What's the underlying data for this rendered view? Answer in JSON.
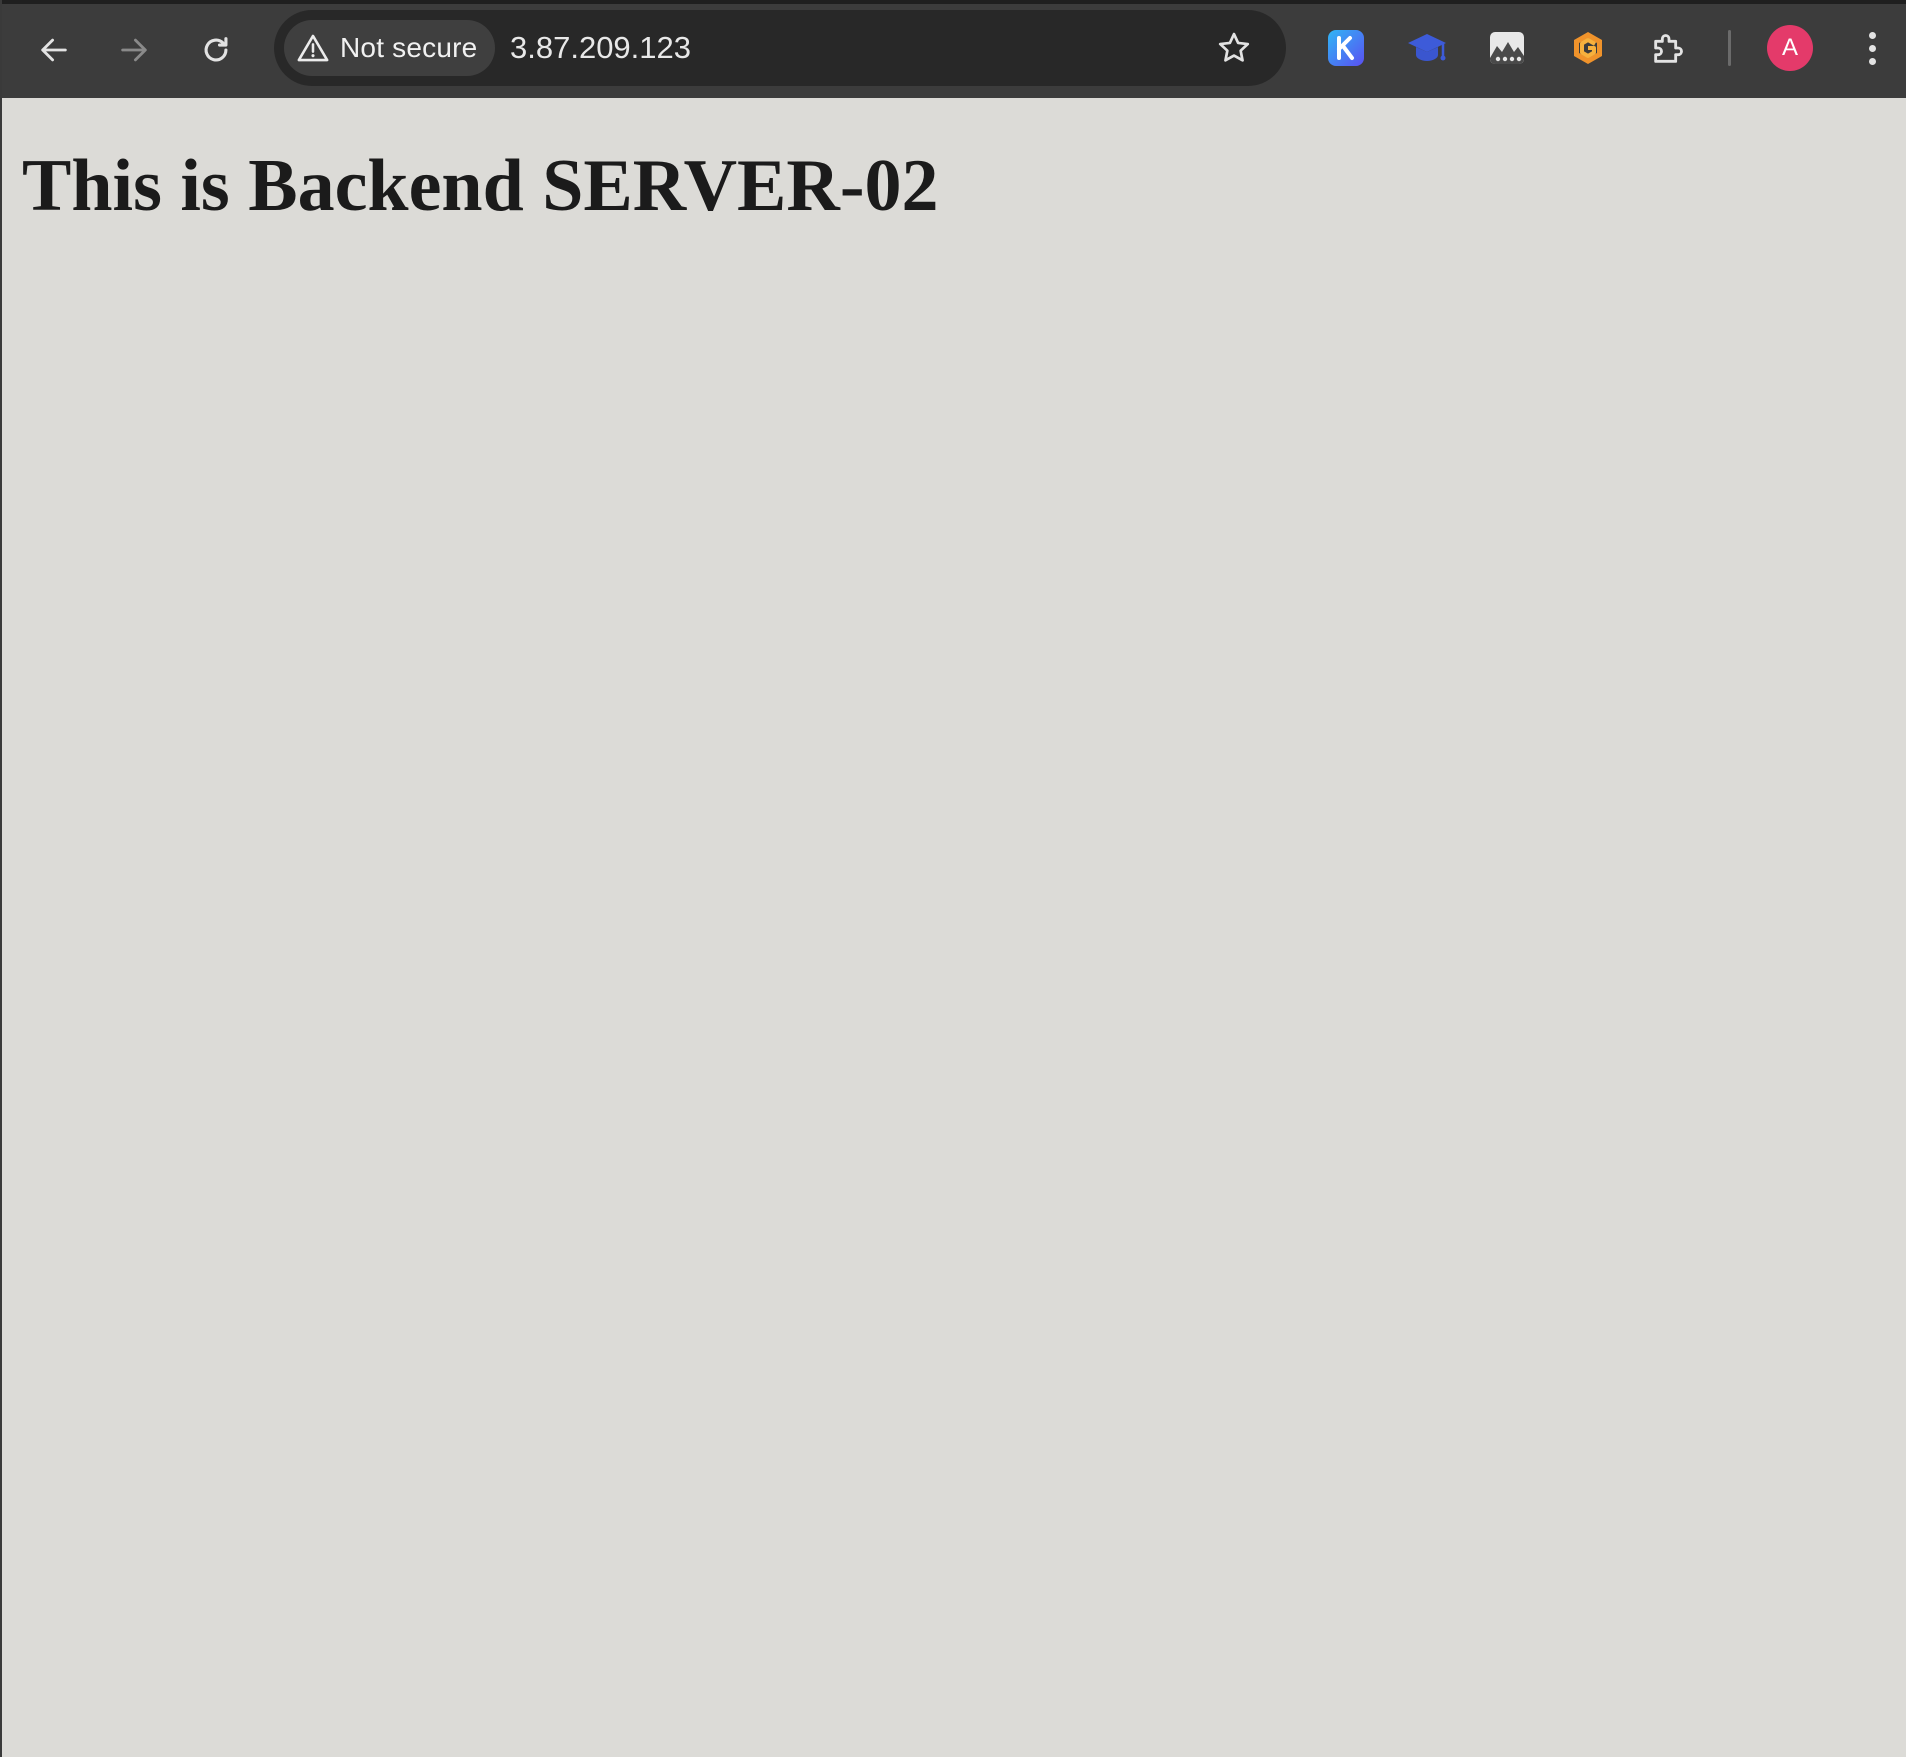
{
  "browser": {
    "security": {
      "label": "Not secure",
      "icon": "warning-triangle-icon"
    },
    "address": {
      "url": "3.87.209.123"
    },
    "extensions": [
      {
        "name": "k-extension-icon",
        "glyph": "K",
        "color": "#3e7bf7"
      },
      {
        "name": "graduation-cap-icon",
        "color": "#3d5bd9"
      },
      {
        "name": "image-extension-icon",
        "color": "#e8e8e8"
      },
      {
        "name": "g-extension-icon",
        "color": "#f0932b"
      },
      {
        "name": "puzzle-piece-icon",
        "color": "#e3e3e3"
      }
    ],
    "profile": {
      "initial": "A",
      "color": "#e43a6a"
    }
  },
  "page": {
    "heading": "This is Backend SERVER-02",
    "background": "#dcdbd7"
  }
}
